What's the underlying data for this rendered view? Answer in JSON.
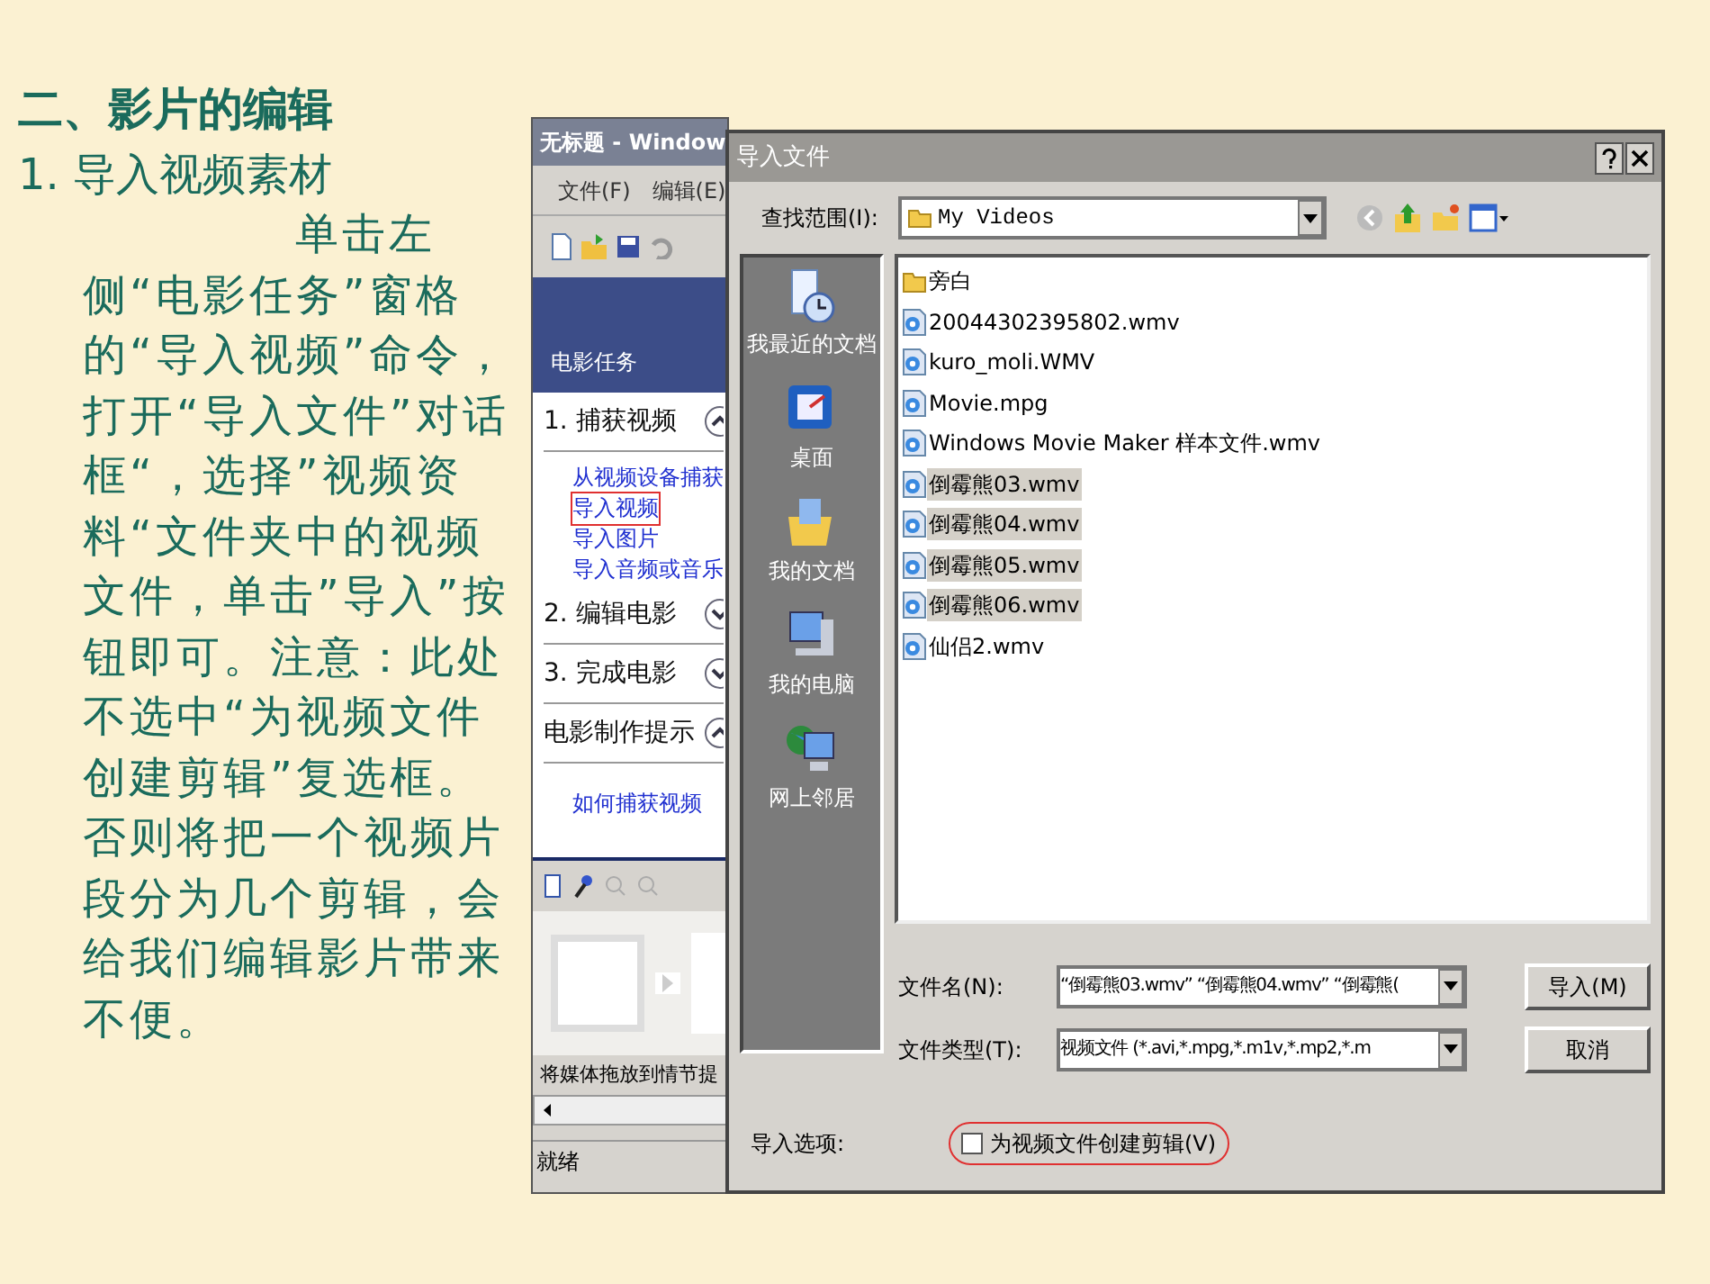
{
  "slide": {
    "heading": "二、影片的编辑",
    "subheading": "1. 导入视频素材",
    "body": "单击左侧“电影任务”窗格的“导入视频”命令，打开“导入文件”对话框“，选择”视频资料“文件夹中的视频文件，单击”导入”按钮即可。注意：此处不选中“为视频文件创建剪辑”复选框。否则将把一个视频片段分为几个剪辑，会给我们编辑影片带来不便。"
  },
  "app_window": {
    "title": "无标题 - Window",
    "menus": [
      "文件(F)",
      "编辑(E)"
    ],
    "pane_title": "电影任务",
    "tasks": [
      {
        "kind": "section",
        "label": "1. 捕获视频",
        "expanded": true
      },
      {
        "kind": "link",
        "label": "从视频设备捕获",
        "highlighted": false
      },
      {
        "kind": "link",
        "label": "导入视频",
        "highlighted": true
      },
      {
        "kind": "link",
        "label": "导入图片",
        "highlighted": false
      },
      {
        "kind": "link",
        "label": "导入音频或音乐",
        "highlighted": false
      },
      {
        "kind": "section",
        "label": "2. 编辑电影",
        "expanded": false
      },
      {
        "kind": "section",
        "label": "3. 完成电影",
        "expanded": false
      },
      {
        "kind": "section",
        "label": "电影制作提示",
        "expanded": true
      },
      {
        "kind": "link",
        "label": "如何捕获视频",
        "highlighted": false
      }
    ],
    "storyboard_hint": "将媒体拖放到情节提",
    "status": "就绪"
  },
  "dialog": {
    "title": "导入文件",
    "look_in_label": "查找范围(I):",
    "look_in": "My Videos",
    "places": [
      "我最近的文档",
      "桌面",
      "我的文档",
      "我的电脑",
      "网上邻居"
    ],
    "files": [
      {
        "kind": "folder",
        "name": "旁白",
        "selected": false
      },
      {
        "kind": "video",
        "name": "20044302395802.wmv",
        "selected": false
      },
      {
        "kind": "video",
        "name": "kuro_moli.WMV",
        "selected": false
      },
      {
        "kind": "video",
        "name": "Movie.mpg",
        "selected": false
      },
      {
        "kind": "video",
        "name": "Windows Movie Maker 样本文件.wmv",
        "selected": false
      },
      {
        "kind": "video",
        "name": "倒霉熊03.wmv",
        "selected": true
      },
      {
        "kind": "video",
        "name": "倒霉熊04.wmv",
        "selected": true
      },
      {
        "kind": "video",
        "name": "倒霉熊05.wmv",
        "selected": true
      },
      {
        "kind": "video",
        "name": "倒霉熊06.wmv",
        "selected": true
      },
      {
        "kind": "video",
        "name": "仙侣2.wmv",
        "selected": false
      }
    ],
    "filename_label": "文件名(N):",
    "filename": "“倒霉熊03.wmv” “倒霉熊04.wmv” “倒霉熊(",
    "filetype_label": "文件类型(T):",
    "filetype": "视频文件 (*.avi,*.mpg,*.m1v,*.mp2,*.m",
    "buttons": [
      "导入(M)",
      "取消"
    ],
    "options_label": "导入选项:",
    "option": {
      "label": "为视频文件创建剪辑(V)",
      "checked": false,
      "annotated": true
    }
  }
}
